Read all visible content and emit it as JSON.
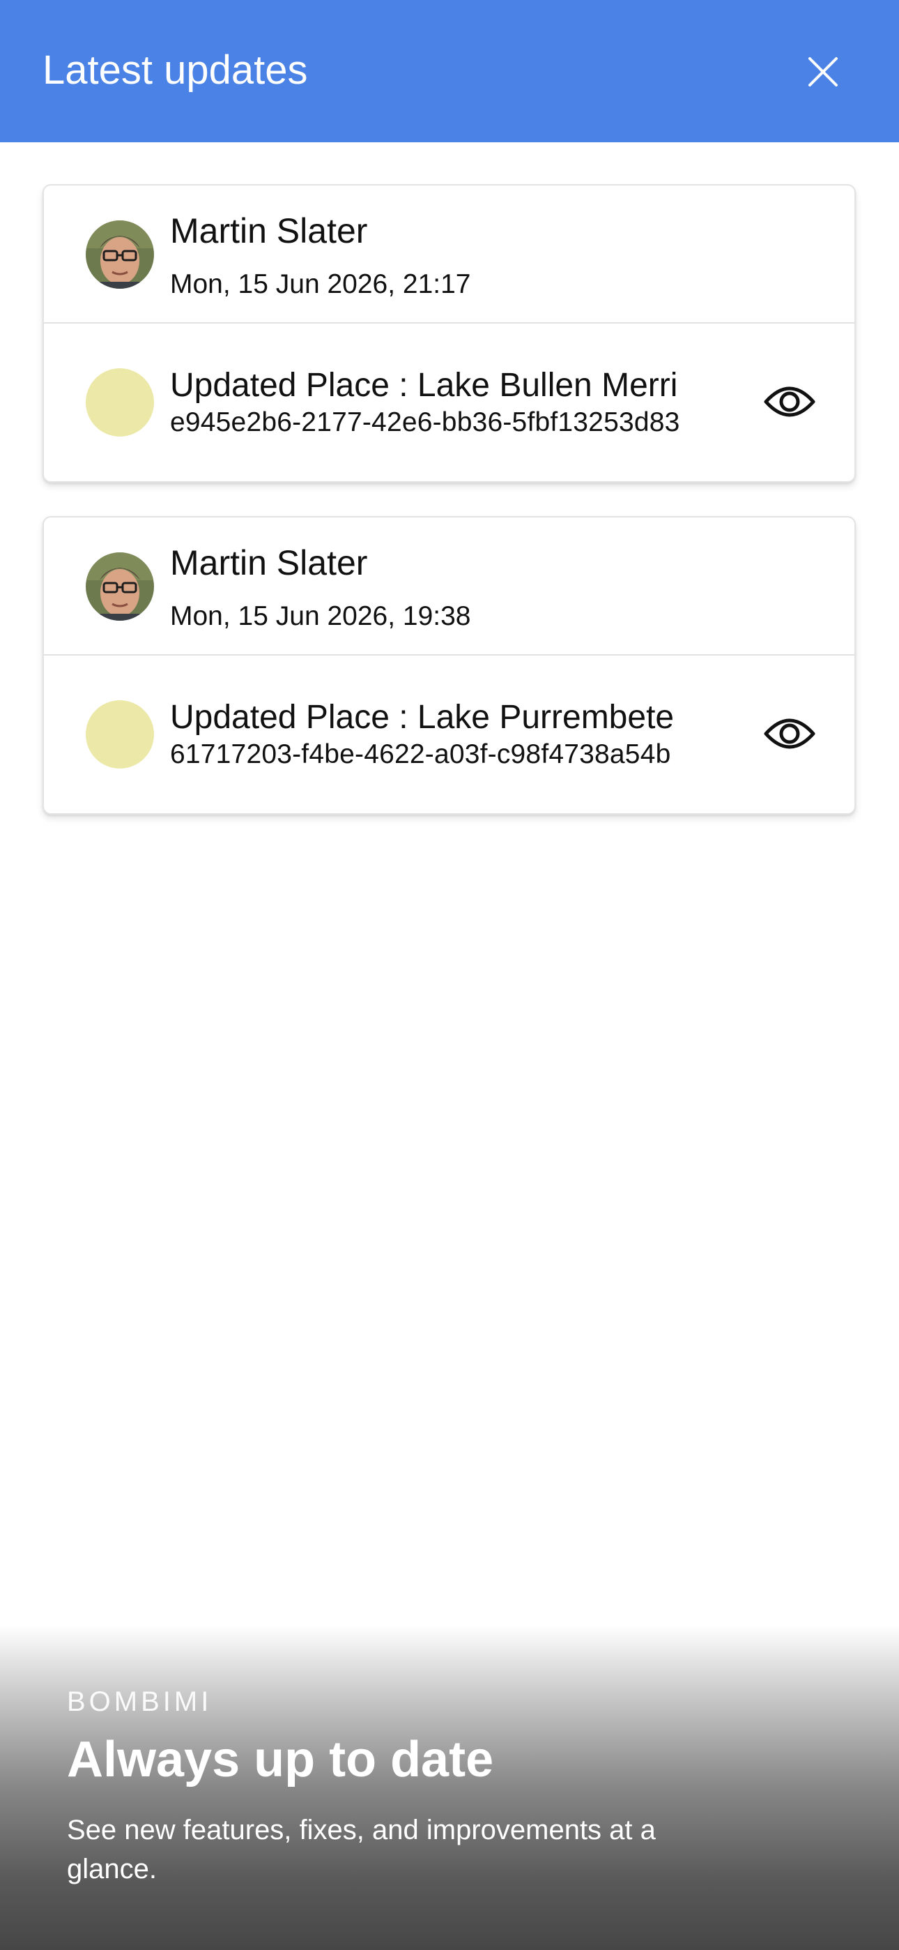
{
  "header": {
    "title": "Latest updates",
    "close_icon": "close-icon",
    "background_color": "#4a82e6"
  },
  "updates": [
    {
      "user": {
        "name": "Martin Slater",
        "avatar": "user-avatar-photo"
      },
      "timestamp": "Mon, 15 Jun 2026, 21:17",
      "title": "Updated Place : Lake Bullen Merri",
      "id": "e945e2b6-2177-42e6-bb36-5fbf13253d83",
      "dot_color": "#ece8a8",
      "action_icon": "eye-icon"
    },
    {
      "user": {
        "name": "Martin Slater",
        "avatar": "user-avatar-photo"
      },
      "timestamp": "Mon, 15 Jun 2026, 19:38",
      "title": "Updated Place : Lake Purrembete",
      "id": "61717203-f4be-4622-a03f-c98f4738a54b",
      "dot_color": "#ece8a8",
      "action_icon": "eye-icon"
    }
  ],
  "promo": {
    "brand": "BOMBIMI",
    "title": "Always up to date",
    "description": "See new features, fixes, and improvements at a glance."
  }
}
